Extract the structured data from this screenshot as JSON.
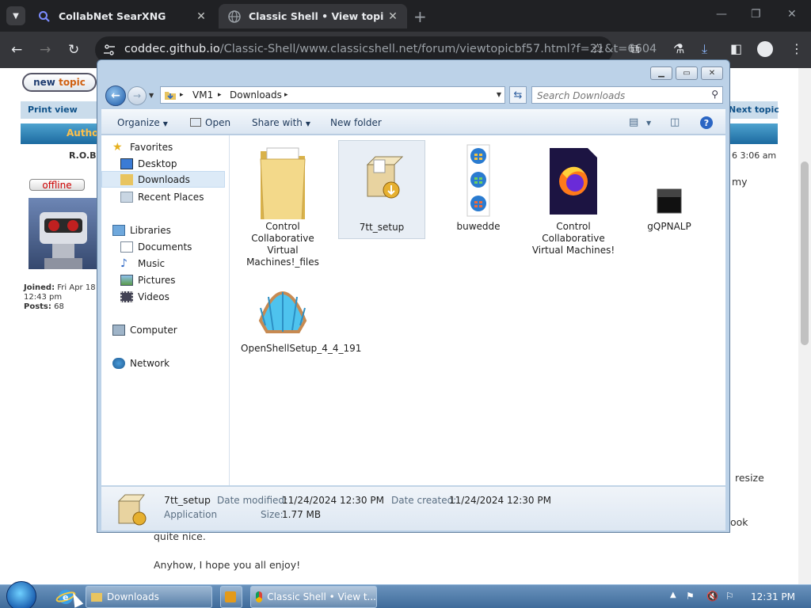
{
  "browser": {
    "tabs": [
      {
        "title": "CollabNet SearXNG"
      },
      {
        "title": "Classic Shell • View topic - Ori"
      }
    ],
    "url_host": "coddec.github.io",
    "url_path": "/Classic-Shell/www.classicshell.net/forum/viewtopicbf57.html?f=21&t=6604"
  },
  "forum": {
    "new_topic_a": "new",
    "new_topic_b": "topic",
    "print_view": "Print view",
    "next_topic": "Next topic",
    "author_header": "Autho",
    "author_name": "R.O.B.",
    "post_time": "6 3:06 am",
    "status": "offline",
    "joined_label": "Joined:",
    "joined_value_1": "Fri Apr 18",
    "joined_value_2": "12:43 pm",
    "posts_label": "Posts:",
    "posts_value": "68",
    "text_fragment_1": "my",
    "text_fragment_2": "resize",
    "text_fragment_3": "ook",
    "text_line_1": "quite nice.",
    "text_line_2": "Anyhow, I hope you all enjoy!"
  },
  "explorer": {
    "breadcrumb": [
      "VM1",
      "Downloads"
    ],
    "search_placeholder": "Search Downloads",
    "commands": {
      "organize": "Organize",
      "open": "Open",
      "share_with": "Share with",
      "new_folder": "New folder"
    },
    "nav": {
      "favorites": "Favorites",
      "desktop": "Desktop",
      "downloads": "Downloads",
      "recent_places": "Recent Places",
      "libraries": "Libraries",
      "documents": "Documents",
      "music": "Music",
      "pictures": "Pictures",
      "videos": "Videos",
      "computer": "Computer",
      "network": "Network"
    },
    "files": [
      {
        "name": "Control Collaborative Virtual Machines!_files",
        "icon": "folder-icon"
      },
      {
        "name": "7tt_setup",
        "icon": "installer-icon"
      },
      {
        "name": "buwedde",
        "icon": "windows-orbs-icon"
      },
      {
        "name": "Control Collaborative Virtual Machines!",
        "icon": "firefox-document-icon"
      },
      {
        "name": "gQPNALP",
        "icon": "black-file-icon"
      },
      {
        "name": "OpenShellSetup_4_4_191",
        "icon": "shell-icon"
      }
    ],
    "details": {
      "name": "7tt_setup",
      "type": "Application",
      "modified_label": "Date modified:",
      "modified": "11/24/2024 12:30 PM",
      "created_label": "Date created:",
      "created": "11/24/2024 12:30 PM",
      "size_label": "Size:",
      "size": "1.77 MB"
    }
  },
  "taskbar": {
    "tasks": [
      {
        "label": "Downloads"
      },
      {
        "label": "Classic Shell • View t..."
      }
    ],
    "clock": "12:31 PM"
  }
}
